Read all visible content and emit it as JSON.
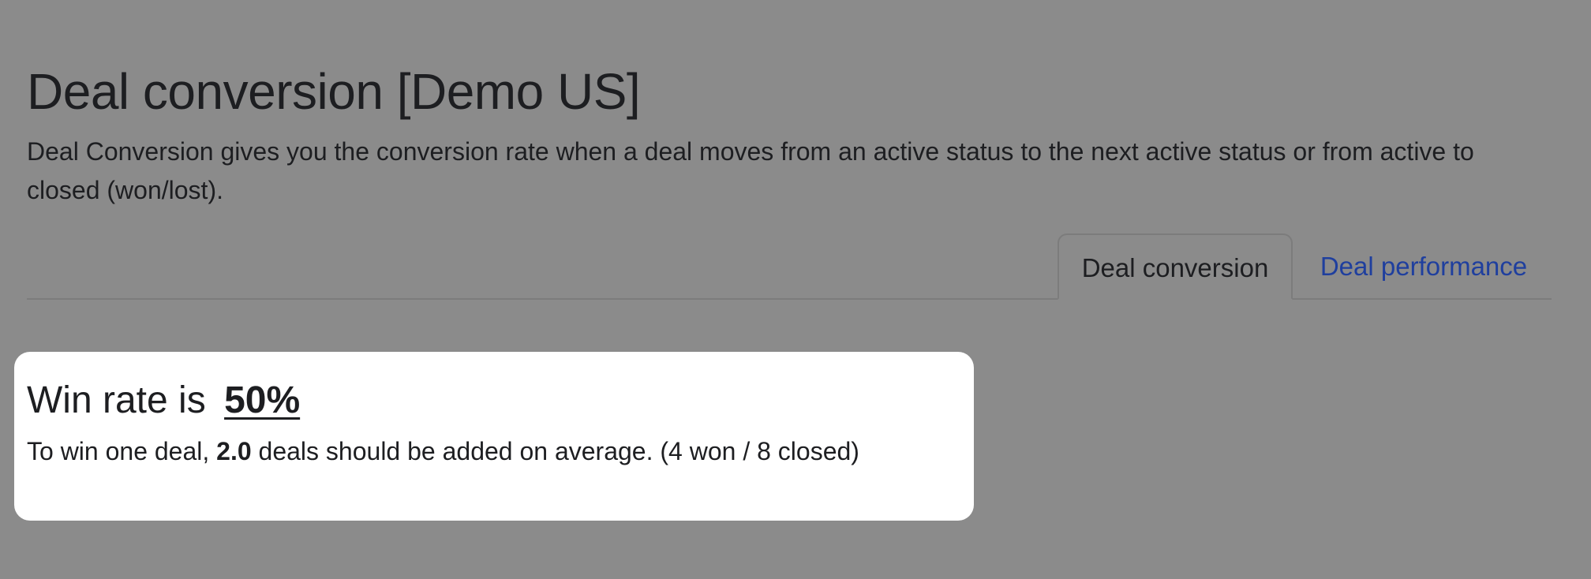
{
  "header": {
    "title": "Deal conversion [Demo US]",
    "description": "Deal Conversion gives you the conversion rate when a deal moves from an active status to the next active status or from active to closed (won/lost)."
  },
  "tabs": [
    {
      "label": "Deal conversion",
      "active": true
    },
    {
      "label": "Deal performance",
      "active": false
    }
  ],
  "win_rate_card": {
    "prefix": "Win rate is",
    "value": "50%",
    "detail_prefix": "To win one deal,",
    "deals_needed": "2.0",
    "detail_suffix": "deals should be added on average. (4 won / 8 closed)"
  },
  "colors": {
    "overlay_background": "#8b8b8b",
    "card_background": "#ffffff",
    "link": "#1f3f9e",
    "text": "#1d1e21"
  }
}
